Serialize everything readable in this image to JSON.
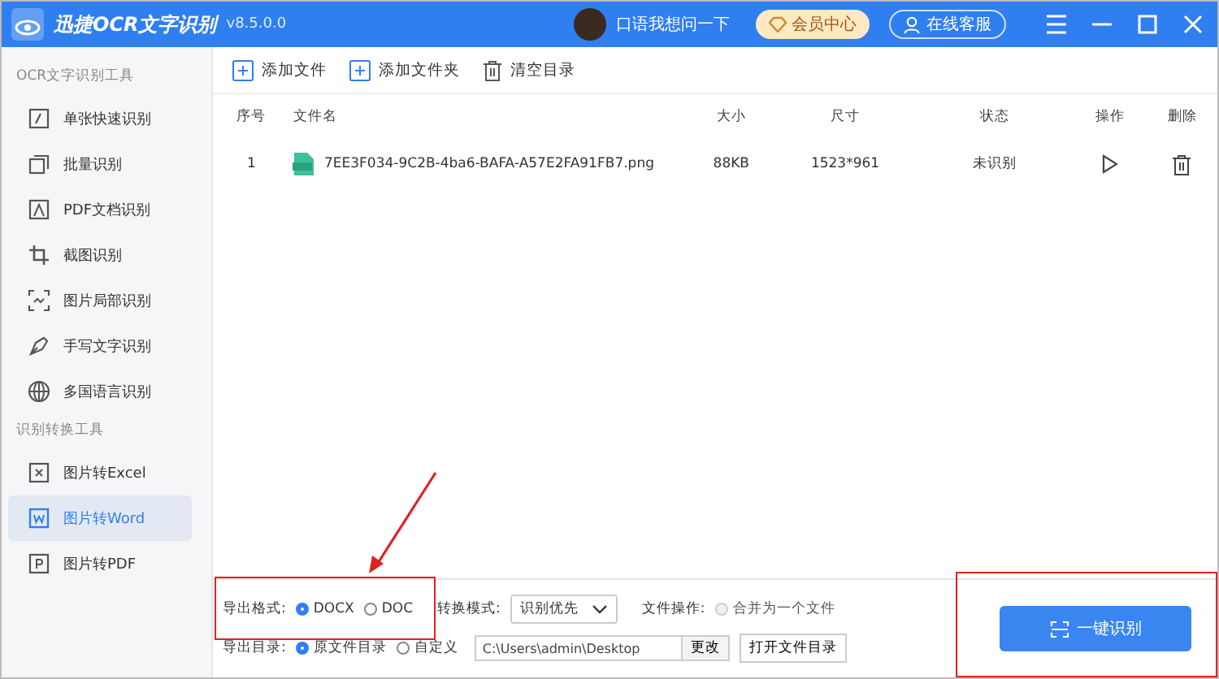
{
  "window": {
    "app_name": "迅捷OCR文字识别",
    "version": "v8.5.0.0",
    "user_name": "口语我想问一下",
    "vip_button": "会员中心",
    "service_button": "在线客服"
  },
  "sidebar": {
    "sections": [
      {
        "title": "OCR文字识别工具",
        "items": [
          {
            "label": "单张快速识别",
            "kind": "scan",
            "selected": false
          },
          {
            "label": "批量识别",
            "kind": "stack",
            "selected": false
          },
          {
            "label": "PDF文档识别",
            "kind": "pdf",
            "selected": false
          },
          {
            "label": "截图识别",
            "kind": "crop",
            "selected": false
          },
          {
            "label": "图片局部识别",
            "kind": "partial",
            "selected": false
          },
          {
            "label": "手写文字识别",
            "kind": "pen",
            "selected": false
          },
          {
            "label": "多国语言识别",
            "kind": "globe",
            "selected": false
          }
        ]
      },
      {
        "title": "识别转换工具",
        "items": [
          {
            "label": "图片转Excel",
            "kind": "x",
            "selected": false
          },
          {
            "label": "图片转Word",
            "kind": "w",
            "selected": true
          },
          {
            "label": "图片转PDF",
            "kind": "p",
            "selected": false
          }
        ]
      }
    ]
  },
  "toolbar": [
    {
      "label": "添加文件",
      "kind": "add"
    },
    {
      "label": "添加文件夹",
      "kind": "add"
    },
    {
      "label": "清空目录",
      "kind": "clear"
    }
  ],
  "table": {
    "columns": [
      "序号",
      "文件名",
      "大小",
      "尺寸",
      "状态",
      "操作",
      "删除"
    ],
    "rows": [
      {
        "index": "1",
        "file_name": "7EE3F034-9C2B-4ba6-BAFA-A57E2FA91FB7.png",
        "size": "88KB",
        "dimensions": "1523*961",
        "status": "未识别"
      }
    ]
  },
  "options": {
    "format_label": "导出格式:",
    "formats": [
      {
        "label": "DOCX",
        "selected": true
      },
      {
        "label": "DOC",
        "selected": false
      }
    ],
    "mode_label": "转换模式:",
    "mode_value": "识别优先",
    "file_op_label": "文件操作:",
    "merge": {
      "label": "合并为一个文件",
      "checked": false,
      "disabled": true
    },
    "dir_label": "导出目录:",
    "dirs": [
      {
        "label": "原文件目录",
        "selected": true
      },
      {
        "label": "自定义",
        "selected": false
      }
    ],
    "path": "C:\\Users\\admin\\Desktop",
    "change_button": "更改",
    "open_button": "打开文件目录"
  },
  "start_button": "一键识别"
}
